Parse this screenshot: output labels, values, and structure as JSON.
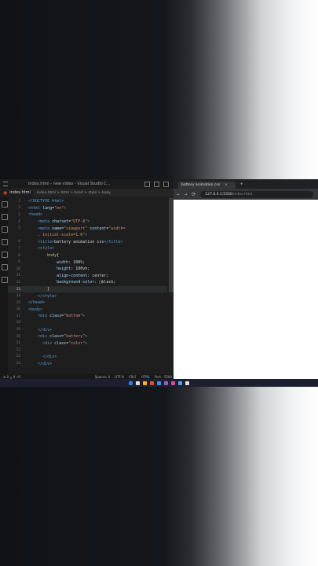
{
  "vscode": {
    "title": "index.html - new video - Visual Studio C...",
    "tab_label": "index.html",
    "breadcrumb": "index.html > html > head > style > body",
    "lines": [
      {
        "n": "1",
        "parts": [
          [
            "tag",
            "<!DOCTYPE html>"
          ]
        ]
      },
      {
        "n": "2",
        "parts": [
          [
            "tag",
            "<html "
          ],
          [
            "attr",
            "lang"
          ],
          [
            "txt",
            "="
          ],
          [
            "str",
            "\"en\""
          ],
          [
            "tag",
            ">"
          ]
        ]
      },
      {
        "n": "3",
        "parts": [
          [
            "tag",
            "<head>"
          ]
        ]
      },
      {
        "n": "4",
        "parts": [
          [
            "txt",
            "    "
          ],
          [
            "tag",
            "<meta "
          ],
          [
            "attr",
            "charset"
          ],
          [
            "txt",
            "="
          ],
          [
            "str",
            "\"UTF-8\""
          ],
          [
            "tag",
            ">"
          ]
        ]
      },
      {
        "n": "5",
        "parts": [
          [
            "txt",
            "    "
          ],
          [
            "tag",
            "<meta "
          ],
          [
            "attr",
            "name"
          ],
          [
            "txt",
            "="
          ],
          [
            "str",
            "\"viewport\" "
          ],
          [
            "attr",
            "content"
          ],
          [
            "txt",
            "="
          ],
          [
            "str",
            "\"width="
          ]
        ]
      },
      {
        "n": "",
        "parts": [
          [
            "txt",
            "    "
          ],
          [
            "str",
            ", initial-scale=1.0\""
          ],
          [
            "tag",
            ">"
          ]
        ]
      },
      {
        "n": "6",
        "parts": [
          [
            "txt",
            "    "
          ],
          [
            "tag",
            "<title>"
          ],
          [
            "txt",
            "battery animation css"
          ],
          [
            "tag",
            "</title>"
          ]
        ]
      },
      {
        "n": "7",
        "parts": [
          [
            "txt",
            "    "
          ],
          [
            "tag",
            "<style>"
          ]
        ]
      },
      {
        "n": "8",
        "parts": [
          [
            "txt",
            "        "
          ],
          [
            "sel",
            "body"
          ],
          [
            "txt",
            "{"
          ]
        ]
      },
      {
        "n": "9",
        "parts": [
          [
            "txt",
            "            "
          ],
          [
            "attr",
            "width"
          ],
          [
            "txt",
            ": 100%;"
          ]
        ]
      },
      {
        "n": "10",
        "parts": [
          [
            "txt",
            "            "
          ],
          [
            "attr",
            "height"
          ],
          [
            "txt",
            ": 100vh;"
          ]
        ]
      },
      {
        "n": "11",
        "parts": [
          [
            "txt",
            "            "
          ],
          [
            "attr",
            "align-content"
          ],
          [
            "txt",
            ": center;"
          ]
        ]
      },
      {
        "n": "12",
        "parts": [
          [
            "txt",
            "            "
          ],
          [
            "attr",
            "background-color"
          ],
          [
            "txt",
            ": "
          ],
          [
            "txt",
            "□black;"
          ]
        ]
      },
      {
        "n": "13",
        "parts": [
          [
            "txt",
            "        }"
          ]
        ]
      },
      {
        "n": "14",
        "parts": [
          [
            "txt",
            "    "
          ],
          [
            "tag",
            "</style>"
          ]
        ]
      },
      {
        "n": "15",
        "parts": [
          [
            "tag",
            "</head>"
          ]
        ]
      },
      {
        "n": "16",
        "parts": [
          [
            "tag",
            "<body>"
          ]
        ]
      },
      {
        "n": "17",
        "parts": [
          [
            "txt",
            "    "
          ],
          [
            "tag",
            "<div "
          ],
          [
            "attr",
            "class"
          ],
          [
            "txt",
            "="
          ],
          [
            "str",
            "\"bottom\""
          ],
          [
            "tag",
            ">"
          ]
        ]
      },
      {
        "n": "18",
        "parts": []
      },
      {
        "n": "19",
        "parts": [
          [
            "txt",
            "    "
          ],
          [
            "tag",
            "</div>"
          ]
        ]
      },
      {
        "n": "20",
        "parts": [
          [
            "txt",
            "    "
          ],
          [
            "tag",
            "<div "
          ],
          [
            "attr",
            "class"
          ],
          [
            "txt",
            "="
          ],
          [
            "str",
            "\"battery\""
          ],
          [
            "tag",
            ">"
          ]
        ]
      },
      {
        "n": "21",
        "parts": [
          [
            "txt",
            "      "
          ],
          [
            "tag",
            "<div "
          ],
          [
            "attr",
            "class"
          ],
          [
            "txt",
            "="
          ],
          [
            "str",
            "\"color\""
          ],
          [
            "tag",
            ">"
          ]
        ]
      },
      {
        "n": "22",
        "parts": []
      },
      {
        "n": "23",
        "parts": [
          [
            "txt",
            "      "
          ],
          [
            "tag",
            "</div>"
          ]
        ]
      },
      {
        "n": "24",
        "parts": [
          [
            "txt",
            "    "
          ],
          [
            "tag",
            "</div>"
          ]
        ]
      }
    ],
    "status_left": "⊗ 0 △ 0   ⚡0",
    "status_right": [
      "Spaces: 4",
      "UTF-8",
      "CRLF",
      "HTML",
      "Port : 5500"
    ]
  },
  "browser": {
    "tab_title": "battery animation css",
    "url": "127.0.0.1:5500",
    "url_path": "/index.html"
  },
  "taskbar": {
    "icon_colors": [
      "#2a7ae2",
      "#e0e0e0",
      "#f3b33d",
      "#e8453c",
      "#3c8ee8",
      "#8e5cd8",
      "#d94b8a",
      "#42a5f5",
      "#e0e0e0"
    ]
  }
}
